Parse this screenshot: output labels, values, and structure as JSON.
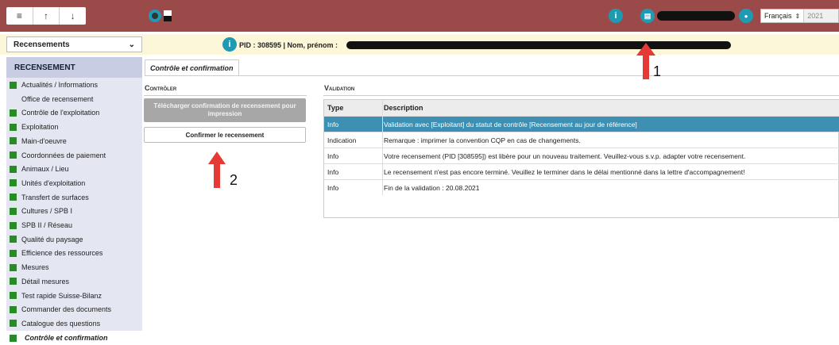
{
  "topbar": {
    "buttons": [
      "≡",
      "↑",
      "↓"
    ],
    "info_icon": "i",
    "doc_icon": "▤",
    "user_icon": "●",
    "language": "Français",
    "year": "2021"
  },
  "selector": {
    "value": "Recensements",
    "arrow": "⌄"
  },
  "infobar": {
    "pid_text": "PID : 308595 | Nom, prénom :"
  },
  "sidebar": {
    "header": "RECENSEMENT",
    "items": [
      {
        "label": "Actualités / Informations",
        "icon": true
      },
      {
        "label": "Office de recensement",
        "icon": false
      },
      {
        "label": "Contrôle de l'exploitation",
        "icon": true
      },
      {
        "label": "Exploitation",
        "icon": true
      },
      {
        "label": "Main-d'oeuvre",
        "icon": true
      },
      {
        "label": "Coordonnées de paiement",
        "icon": true
      },
      {
        "label": "Animaux / Lieu",
        "icon": true
      },
      {
        "label": "Unités d'exploitation",
        "icon": true
      },
      {
        "label": "Transfert de surfaces",
        "icon": true
      },
      {
        "label": "Cultures / SPB I",
        "icon": true
      },
      {
        "label": "SPB II / Réseau",
        "icon": true
      },
      {
        "label": "Qualité du paysage",
        "icon": true
      },
      {
        "label": "Efficience des ressources",
        "icon": true
      },
      {
        "label": "Mesures",
        "icon": true
      },
      {
        "label": "Détail mesures",
        "icon": true
      },
      {
        "label": "Test rapide Suisse-Bilanz",
        "icon": true
      },
      {
        "label": "Commander des documents",
        "icon": true
      },
      {
        "label": "Catalogue des questions",
        "icon": true
      }
    ],
    "active": "Contrôle et confirmation"
  },
  "tab": {
    "label": "Contrôle et confirmation"
  },
  "controler": {
    "title": "Contrôler",
    "download_label": "Télécharger confirmation de recensement pour impression",
    "confirm_label": "Confirmer le recensement"
  },
  "validation": {
    "title": "Validation",
    "headers": [
      "Type",
      "Description"
    ],
    "rows": [
      {
        "type": "Info",
        "desc": "Validation avec [Exploitant] du statut de contrôle [Recensement au jour de référence]"
      },
      {
        "type": "Indication",
        "desc": "Remarque : imprimer la convention CQP en cas de changements."
      },
      {
        "type": "Info",
        "desc": "Votre recensement (PID [308595]) est libère pour un nouveau traitement. Veuillez-vous s.v.p. adapter votre recensement."
      },
      {
        "type": "Info",
        "desc": "Le recensement n'est pas encore terminé. Veuillez le terminer dans le délai mentionné dans la lettre d'accompagnement!"
      },
      {
        "type": "Info",
        "desc": "Fin de la validation : 20.08.2021"
      }
    ]
  },
  "annotations": {
    "one": "1",
    "two": "2"
  },
  "colors": {
    "topbar": "#9b4a4a",
    "accent": "#1e9ab3",
    "highlight_row": "#3d8fb3",
    "sidebar_square": "#2a8a2a",
    "arrow": "#e53935"
  }
}
